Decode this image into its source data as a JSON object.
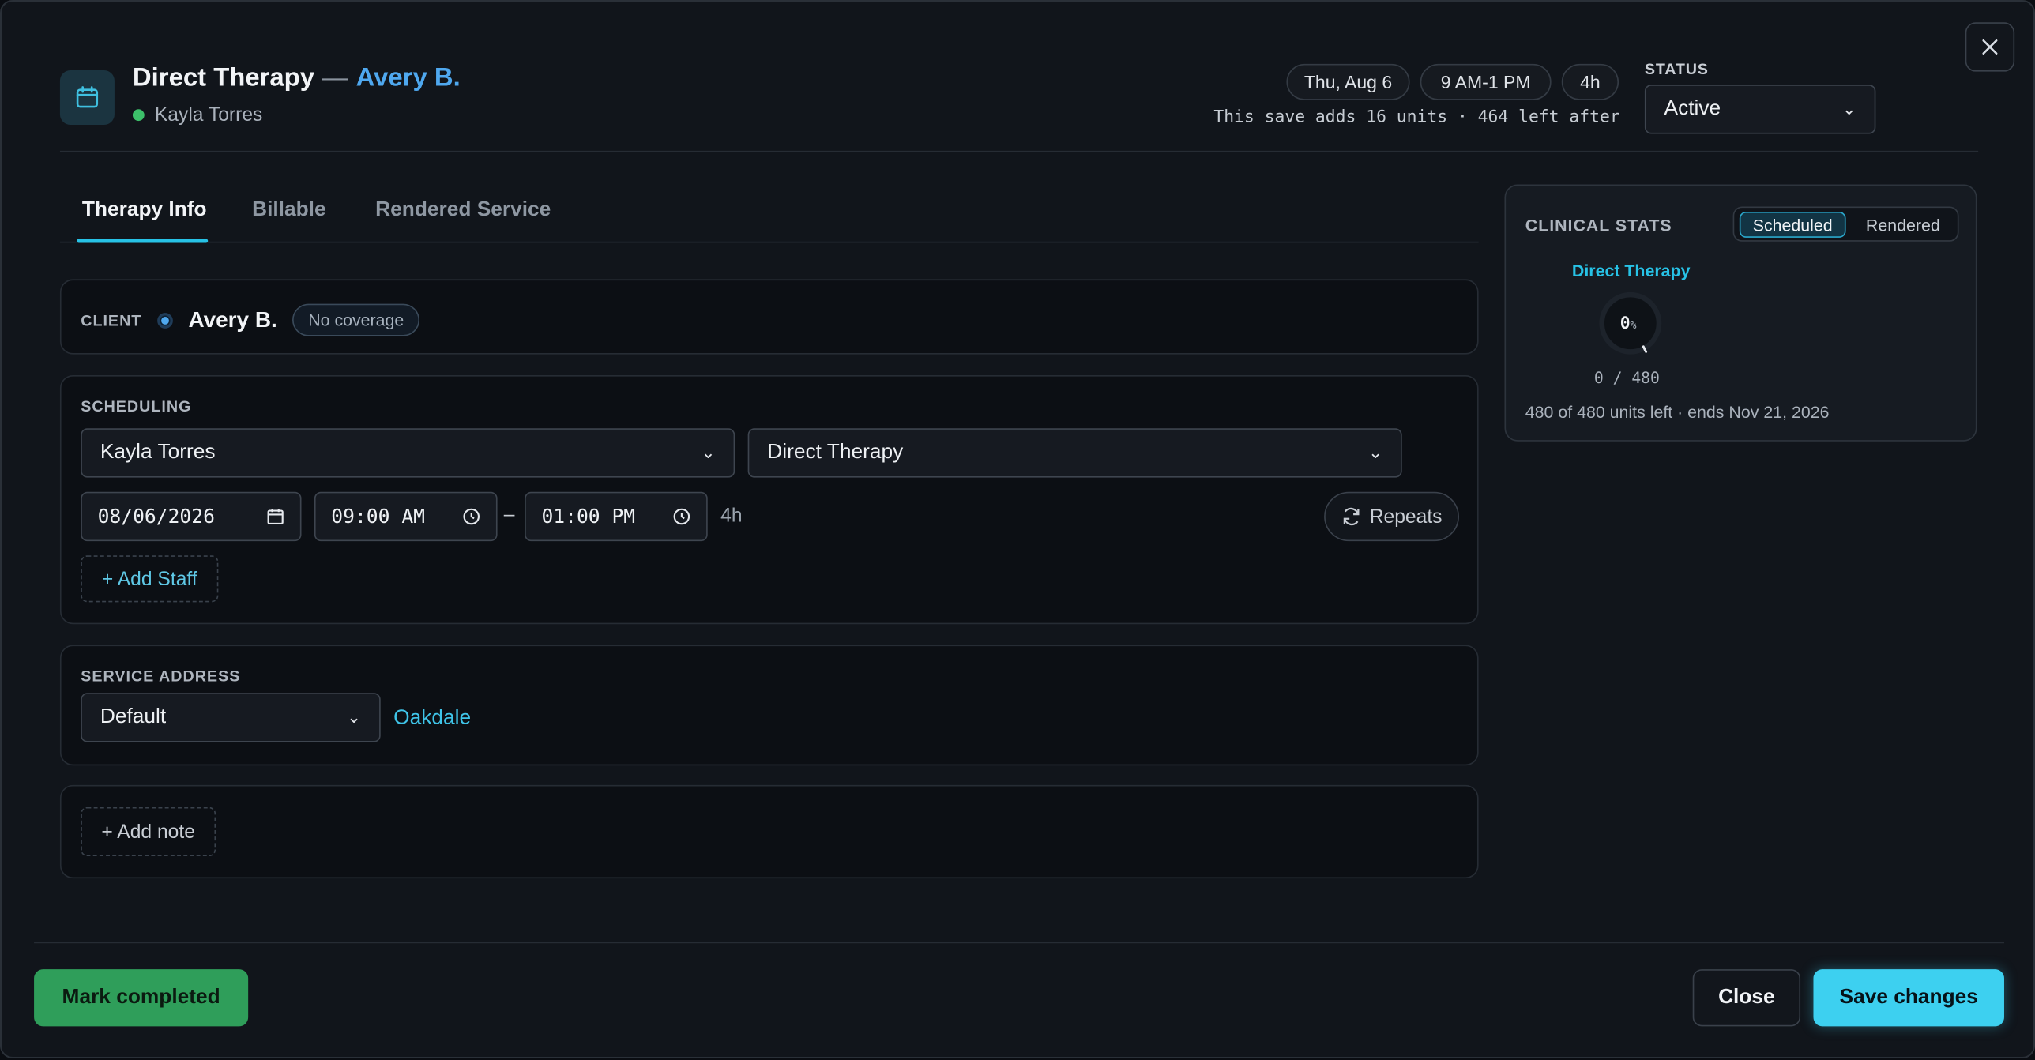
{
  "header": {
    "title": "Direct Therapy",
    "separator": "—",
    "client": "Avery B.",
    "staff": "Kayla Torres",
    "chips": [
      "Thu, Aug 6",
      "9 AM-1 PM",
      "4h"
    ],
    "units_note": "This save adds 16 units · 464 left after",
    "status_label": "STATUS",
    "status_value": "Active",
    "close_icon": "close-icon"
  },
  "tabs": [
    {
      "label": "Therapy Info",
      "active": true
    },
    {
      "label": "Billable",
      "active": false
    },
    {
      "label": "Rendered Service",
      "active": false
    }
  ],
  "client_section": {
    "label": "CLIENT",
    "name": "Avery B.",
    "badge": "No coverage"
  },
  "scheduling": {
    "label": "SCHEDULING",
    "staff_select": "Kayla Torres",
    "service_select": "Direct Therapy",
    "date": "08/06/2026",
    "start_time": "09:00 AM",
    "range_sep": "–",
    "end_time": "01:00 PM",
    "duration": "4h",
    "repeats_label": "Repeats",
    "add_staff_label": "+ Add Staff"
  },
  "service_address": {
    "label": "SERVICE ADDRESS",
    "select_value": "Default",
    "location_link": "Oakdale"
  },
  "notes": {
    "add_note_label": "+ Add note"
  },
  "clinical_stats": {
    "title": "CLINICAL STATS",
    "toggle": [
      "Scheduled",
      "Rendered"
    ],
    "active_toggle": "Scheduled",
    "service": "Direct Therapy",
    "percent": "0",
    "percent_sign": "%",
    "progress_fraction": 0,
    "used_total": "0 / 480",
    "units_left": "480 of 480 units left · ends Nov 21, 2026"
  },
  "footer": {
    "mark_completed": "Mark completed",
    "close": "Close",
    "save": "Save changes"
  },
  "colors": {
    "accent": "#27c2e6",
    "client_blue": "#4fa8ef",
    "success": "#2f9e5a",
    "background": "#11151b"
  }
}
